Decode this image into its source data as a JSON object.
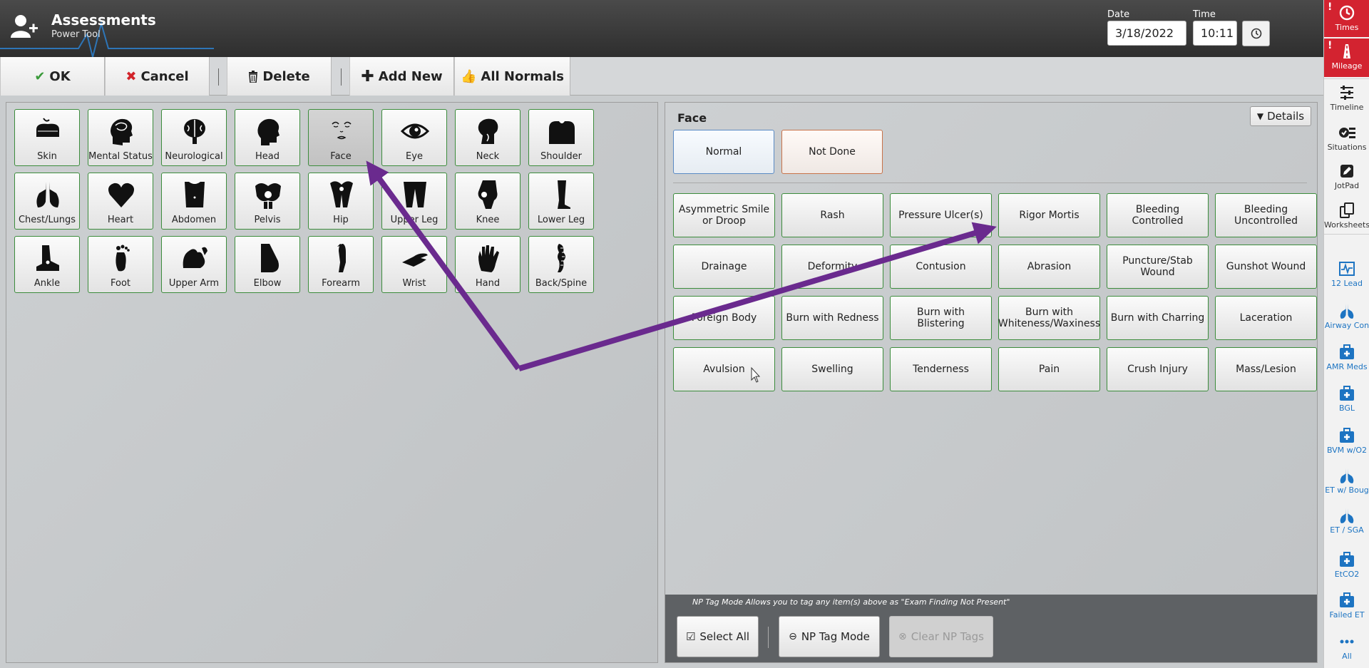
{
  "header": {
    "title": "Assessments",
    "subtitle": "Power Tool",
    "date_label": "Date",
    "date_value": "3/18/2022",
    "time_label": "Time",
    "time_value": "10:11"
  },
  "toolbar": {
    "ok": "OK",
    "cancel": "Cancel",
    "delete": "Delete",
    "add_new": "Add New",
    "all_normals": "All Normals"
  },
  "body_parts": [
    {
      "label": "Skin",
      "icon": "skin-icon"
    },
    {
      "label": "Mental Status",
      "icon": "head-brain-icon"
    },
    {
      "label": "Neurological",
      "icon": "brain-icon"
    },
    {
      "label": "Head",
      "icon": "head-icon"
    },
    {
      "label": "Face",
      "icon": "face-icon",
      "selected": true
    },
    {
      "label": "Eye",
      "icon": "eye-icon"
    },
    {
      "label": "Neck",
      "icon": "neck-icon"
    },
    {
      "label": "Shoulder",
      "icon": "shoulder-icon"
    },
    {
      "label": "Chest/Lungs",
      "icon": "lungs-icon"
    },
    {
      "label": "Heart",
      "icon": "heart-icon"
    },
    {
      "label": "Abdomen",
      "icon": "abdomen-icon"
    },
    {
      "label": "Pelvis",
      "icon": "pelvis-icon"
    },
    {
      "label": "Hip",
      "icon": "hip-icon"
    },
    {
      "label": "Upper Leg",
      "icon": "upper-leg-icon"
    },
    {
      "label": "Knee",
      "icon": "knee-icon"
    },
    {
      "label": "Lower Leg",
      "icon": "lower-leg-icon"
    },
    {
      "label": "Ankle",
      "icon": "ankle-icon"
    },
    {
      "label": "Foot",
      "icon": "foot-icon"
    },
    {
      "label": "Upper Arm",
      "icon": "upper-arm-icon"
    },
    {
      "label": "Elbow",
      "icon": "elbow-icon"
    },
    {
      "label": "Forearm",
      "icon": "forearm-icon"
    },
    {
      "label": "Wrist",
      "icon": "wrist-icon"
    },
    {
      "label": "Hand",
      "icon": "hand-icon"
    },
    {
      "label": "Back/Spine",
      "icon": "spine-icon"
    }
  ],
  "detail": {
    "title": "Face",
    "details_btn": "Details",
    "normal": "Normal",
    "not_done": "Not Done",
    "findings": [
      "Asymmetric Smile or Droop",
      "Rash",
      "Pressure Ulcer(s)",
      "Rigor Mortis",
      "Bleeding Controlled",
      "Bleeding Uncontrolled",
      "Drainage",
      "Deformity",
      "Contusion",
      "Abrasion",
      "Puncture/Stab Wound",
      "Gunshot Wound",
      "Foreign Body",
      "Burn with Redness",
      "Burn with Blistering",
      "Burn with Whiteness/Waxiness",
      "Burn with Charring",
      "Laceration",
      "Avulsion",
      "Swelling",
      "Tenderness",
      "Pain",
      "Crush Injury",
      "Mass/Lesion"
    ],
    "np_note": "NP Tag Mode Allows you to tag any item(s) above as \"Exam Finding Not Present\"",
    "select_all": "Select All",
    "np_tag_mode": "NP Tag Mode",
    "clear_np_tags": "Clear NP Tags"
  },
  "sidebar": [
    {
      "label": "Times",
      "icon": "clock-icon",
      "alert": true
    },
    {
      "label": "Mileage",
      "icon": "road-icon",
      "alert": true
    },
    {
      "label": "Timeline",
      "icon": "sliders-icon"
    },
    {
      "label": "Situations",
      "icon": "checklist-icon"
    },
    {
      "label": "JotPad",
      "icon": "pencil-icon"
    },
    {
      "label": "Worksheets",
      "icon": "copy-icon"
    },
    {
      "label": "12 Lead",
      "icon": "ecg-icon"
    },
    {
      "label": "Airway Con",
      "icon": "lungs-icon"
    },
    {
      "label": "AMR Meds",
      "icon": "medkit-icon"
    },
    {
      "label": "BGL",
      "icon": "medkit-icon"
    },
    {
      "label": "BVM w/O2",
      "icon": "medkit-icon"
    },
    {
      "label": "ET w/ Boug",
      "icon": "lungs-icon"
    },
    {
      "label": "ET / SGA",
      "icon": "lungs-icon"
    },
    {
      "label": "EtCO2",
      "icon": "medkit-icon"
    },
    {
      "label": "Failed ET",
      "icon": "medkit-icon"
    },
    {
      "label": "All",
      "icon": "more-icon"
    }
  ],
  "colors": {
    "accent_green": "#3c8c3c",
    "alert_red": "#d32330",
    "sidebar_blue": "#1d74c2",
    "arrow_purple": "#6a2a8e"
  }
}
